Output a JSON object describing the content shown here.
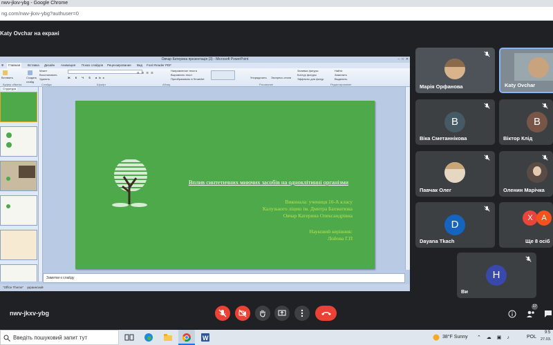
{
  "browser": {
    "window_title": "nwv-jkxv-ybg - Google Chrome",
    "url": "ng.com/nwv-jkxv-ybg?authuser=0"
  },
  "meet": {
    "presenter_banner": "Katy Ovchar на екрані",
    "meeting_code": "nwv-jkxv-ybg",
    "participant_count": "17",
    "participants": [
      {
        "name": "Марія Орфанова",
        "kind": "photo",
        "mic_off": true
      },
      {
        "name": "Katy Ovchar",
        "kind": "photo",
        "mic_off": false,
        "active": true
      },
      {
        "name": "Віка Сметаннікова",
        "kind": "letter",
        "letter": "В",
        "color": "#455a64",
        "mic_off": true
      },
      {
        "name": "Віктор Клід",
        "kind": "letter",
        "letter": "В",
        "color": "#795548",
        "mic_off": true
      },
      {
        "name": "Павчак Олег",
        "kind": "photo",
        "mic_off": true
      },
      {
        "name": "Оленин Марічка",
        "kind": "photo",
        "mic_off": true
      },
      {
        "name": "Dayana Tkach",
        "kind": "letter",
        "letter": "D",
        "color": "#1565c0",
        "mic_off": true
      },
      {
        "name": "Ще 8 осіб",
        "kind": "more",
        "letters": [
          "Х",
          "А"
        ],
        "colors": [
          "#e8453c",
          "#f4511e"
        ]
      },
      {
        "name": "Ви",
        "kind": "letter",
        "letter": "H",
        "color": "#3949ab",
        "mic_off": true
      }
    ]
  },
  "powerpoint": {
    "window_title": "Овчар Катерина презентація (3) - Microsoft PowerPoint",
    "tabs": [
      "Главная",
      "Вставка",
      "Дизайн",
      "Анимация",
      "Показ слайдов",
      "Рецензирование",
      "Вид",
      "Foxit Reader PDF"
    ],
    "file_tab": "Ф",
    "ribbon": {
      "paste_label": "Вставить",
      "create_slide_label": "Создать слайд",
      "layout_label": "Макет",
      "restore_label": "Восстановить",
      "delete_label": "Удалить",
      "direction_label": "Направление текста",
      "align_text_label": "Выровнять текст",
      "convert_label": "Преобразовать в SmartArt",
      "arrange_label": "Упорядочить",
      "quick_styles_label": "Экспресс-стили",
      "fill_label": "Заливка фигуры",
      "outline_label": "Контур фигуры",
      "effects_label": "Эффекты для фигур",
      "find_label": "Найти",
      "replace_label": "Заменить",
      "select_label": "Выделить",
      "groups": [
        "Буфер обмена",
        "Слайды",
        "Шрифт",
        "Абзац",
        "Рисование",
        "Редактирование"
      ]
    },
    "thumbnails_tab": "Структура",
    "slide": {
      "title": "Вплив синтетичних миючих засобів на одноклітинні організми",
      "author_lines": [
        "Виконала: учениця 10-А класу",
        "Калузького ліцею ім. Дмитра Бахматюка",
        "Овчар Катерина Олександрівна"
      ],
      "advisor_lines": [
        "Науковий керівник:",
        "Лойова Г.П"
      ]
    },
    "notes_placeholder": "Заметки к слайду",
    "status": {
      "theme": "\"Office Theme\"",
      "language": "украинский"
    }
  },
  "taskbar": {
    "search_placeholder": "Введіть пошуковий запит тут",
    "weather": "38°F  Sunny",
    "language": "POL",
    "time": "9:5",
    "date": "27.03."
  }
}
